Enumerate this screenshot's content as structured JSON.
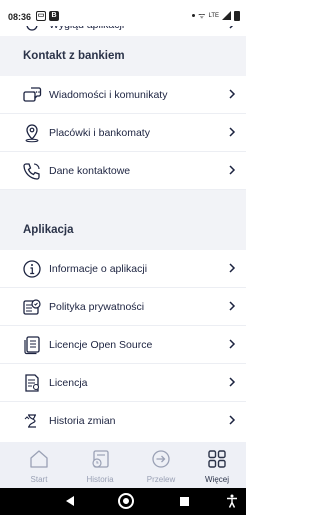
{
  "status_bar": {
    "time": "08:36",
    "right_text": "LTE"
  },
  "partial_item": {
    "label": "Wygląd aplikacji",
    "icon": "appearance-icon"
  },
  "sections": [
    {
      "title": "Kontakt z bankiem",
      "items": [
        {
          "label": "Wiadomości i komunikaty",
          "icon": "messages-icon"
        },
        {
          "label": "Placówki i bankomaty",
          "icon": "location-pin-icon"
        },
        {
          "label": "Dane kontaktowe",
          "icon": "phone-icon"
        }
      ]
    },
    {
      "title": "Aplikacja",
      "items": [
        {
          "label": "Informacje o aplikacji",
          "icon": "info-icon"
        },
        {
          "label": "Polityka prywatności",
          "icon": "privacy-icon"
        },
        {
          "label": "Licencje Open Source",
          "icon": "licenses-icon"
        },
        {
          "label": "Licencja",
          "icon": "license-icon"
        },
        {
          "label": "Historia zmian",
          "icon": "history-icon"
        }
      ]
    }
  ],
  "tabbar": {
    "tabs": [
      {
        "label": "Start",
        "icon": "home-icon",
        "active": false
      },
      {
        "label": "Historia",
        "icon": "history-tab-icon",
        "active": false
      },
      {
        "label": "Przelew",
        "icon": "transfer-icon",
        "active": false
      },
      {
        "label": "Więcej",
        "icon": "more-grid-icon",
        "active": true
      }
    ]
  },
  "colors": {
    "section_bg": "#f2f3f7",
    "text": "#1c2340",
    "accent": "#1c2340",
    "inactive": "#9aa1b5"
  }
}
